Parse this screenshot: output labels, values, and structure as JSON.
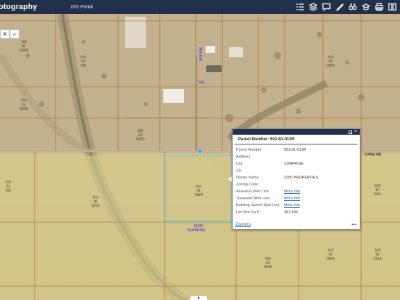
{
  "header": {
    "app_title": "otography",
    "portal_title": "GIS Portal",
    "tools": [
      "list-icon",
      "layers-icon",
      "comment-icon",
      "measure-icon",
      "binoculars-icon",
      "education-icon",
      "print-icon",
      "split-view-icon"
    ]
  },
  "search": {
    "close": "✕",
    "search": "⌕"
  },
  "map_labels": {
    "road_top": "53E",
    "road_side": "3B4 AVE",
    "road_right": "TOPAZ RD",
    "parcel_a": "85387",
    "parcel_b": "SURPRISE",
    "parcels": [
      {
        "lines": [
          "503",
          "81",
          "002M"
        ]
      },
      {
        "lines": [
          "503",
          "81",
          "002N"
        ]
      },
      {
        "lines": [
          "503",
          "81",
          "002"
        ]
      },
      {
        "lines": [
          "503",
          "33",
          "003D"
        ]
      },
      {
        "lines": [
          "503",
          "81",
          "002"
        ]
      },
      {
        "lines": [
          "503",
          "81",
          "001A"
        ]
      },
      {
        "lines": [
          "503",
          "81",
          "013R"
        ]
      },
      {
        "lines": [
          "503",
          "81",
          "004L"
        ]
      },
      {
        "lines": [
          "503",
          "81",
          "005A"
        ]
      },
      {
        "lines": [
          "503",
          "81",
          "010A"
        ]
      },
      {
        "lines": [
          "503",
          "81",
          "003A"
        ]
      },
      {
        "lines": [
          "503",
          "81",
          "012R"
        ]
      }
    ]
  },
  "popup": {
    "title": "Parcel Number: 503-81-013R",
    "rows": [
      {
        "key": "Parcel Number",
        "value": "503-81-013R",
        "link": false
      },
      {
        "key": "Address",
        "value": "",
        "link": false
      },
      {
        "key": "City",
        "value": "SURPRISE",
        "link": false
      },
      {
        "key": "Zip",
        "value": "",
        "link": false
      },
      {
        "key": "Owner Name",
        "value": "3250 PROPERTIES",
        "link": false
      },
      {
        "key": "Zoning Code",
        "value": "",
        "link": false
      },
      {
        "key": "Assessor Web Link",
        "value": "More info",
        "link": true
      },
      {
        "key": "Treasurer Web Link",
        "value": "More info",
        "link": true
      },
      {
        "key": "Building Sketch Web Link",
        "value": "More info",
        "link": true
      },
      {
        "key": "Lot Size Sq.ft.",
        "value": "402,494",
        "link": false
      }
    ],
    "zoom_to": "Zoom to",
    "more": "•••"
  },
  "bottom_handle": "▲"
}
